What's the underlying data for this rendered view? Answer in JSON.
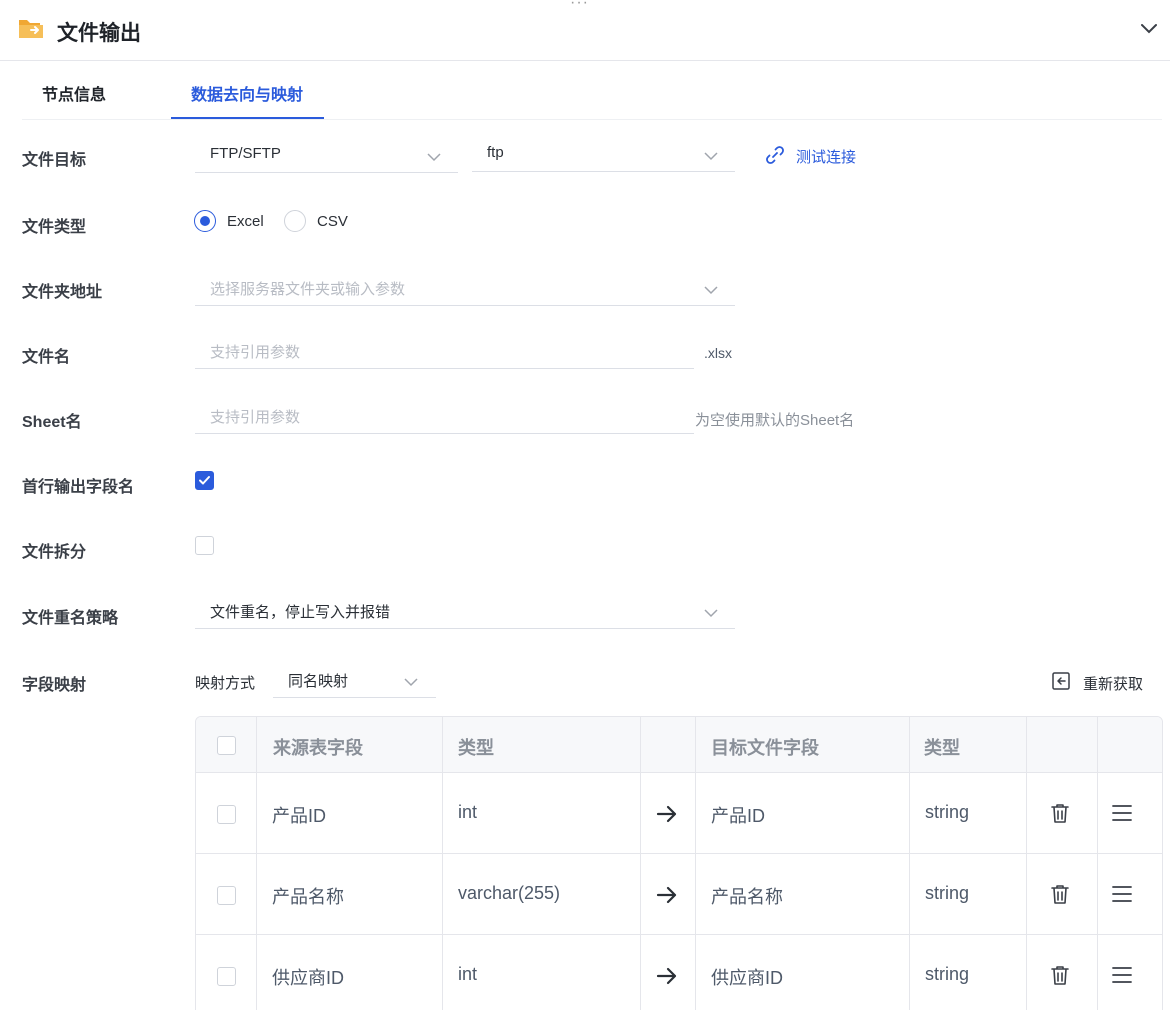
{
  "header": {
    "title": "文件输出",
    "drag_handle": "···"
  },
  "tabs": [
    {
      "label": "节点信息",
      "active": false
    },
    {
      "label": "数据去向与映射",
      "active": true
    }
  ],
  "form": {
    "file_target": {
      "label": "文件目标",
      "protocol": "FTP/SFTP",
      "connection": "ftp",
      "test_label": "测试连接"
    },
    "file_type": {
      "label": "文件类型",
      "options": [
        "Excel",
        "CSV"
      ],
      "selected": "Excel"
    },
    "folder": {
      "label": "文件夹地址",
      "placeholder": "选择服务器文件夹或输入参数"
    },
    "filename": {
      "label": "文件名",
      "placeholder": "支持引用参数",
      "suffix": ".xlsx"
    },
    "sheet": {
      "label": "Sheet名",
      "placeholder": "支持引用参数",
      "hint": "为空使用默认的Sheet名"
    },
    "header_row": {
      "label": "首行输出字段名",
      "checked": true
    },
    "split": {
      "label": "文件拆分",
      "checked": false
    },
    "rename": {
      "label": "文件重名策略",
      "value": "文件重名，停止写入并报错"
    },
    "mapping": {
      "label": "字段映射",
      "mode_label": "映射方式",
      "mode_value": "同名映射",
      "refresh_label": "重新获取"
    }
  },
  "table": {
    "headers": {
      "source_field": "来源表字段",
      "source_type": "类型",
      "target_field": "目标文件字段",
      "target_type": "类型"
    },
    "rows": [
      {
        "source_field": "产品ID",
        "source_type": "int",
        "target_field": "产品ID",
        "target_type": "string"
      },
      {
        "source_field": "产品名称",
        "source_type": "varchar(255)",
        "target_field": "产品名称",
        "target_type": "string"
      },
      {
        "source_field": "供应商ID",
        "source_type": "int",
        "target_field": "供应商ID",
        "target_type": "string"
      }
    ]
  },
  "colors": {
    "accent": "#2b5bdc",
    "folder_icon": "#f0a733"
  }
}
